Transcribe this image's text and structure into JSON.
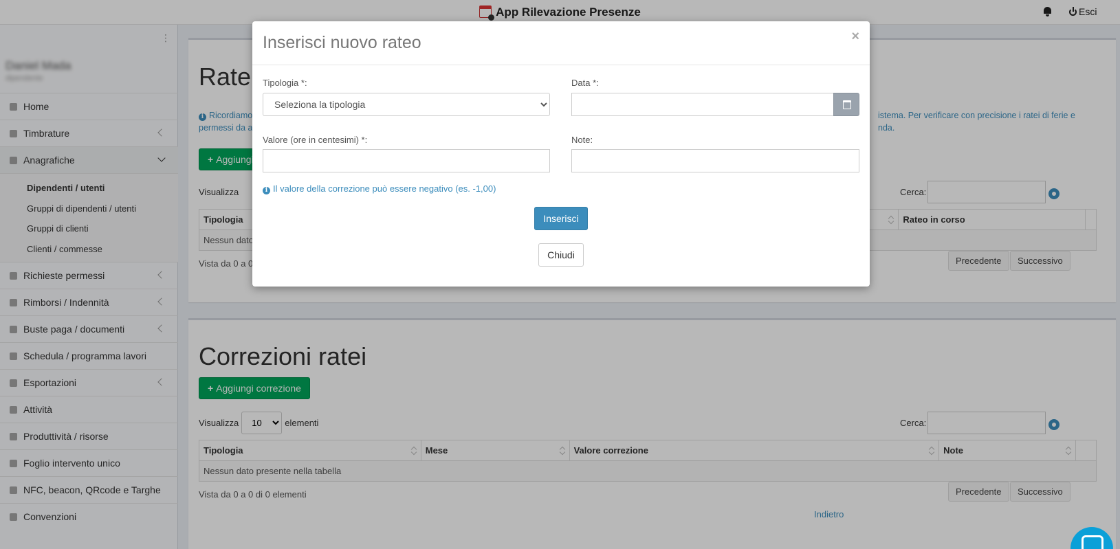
{
  "app": {
    "title": "App Rilevazione Presenze",
    "logout_label": "Esci"
  },
  "sidebar": {
    "user_name": "Daniel Mada",
    "user_sub": "dipendente",
    "items": [
      {
        "label": "Home",
        "icon": "home-icon"
      },
      {
        "label": "Timbrature",
        "icon": "list-icon"
      },
      {
        "label": "Anagrafiche",
        "icon": "users-icon"
      },
      {
        "label": "Richieste permessi",
        "icon": "comment-icon"
      },
      {
        "label": "Rimborsi / Indennità",
        "icon": "book-icon"
      },
      {
        "label": "Buste paga / documenti",
        "icon": "file-icon"
      },
      {
        "label": "Schedula / programma lavori",
        "icon": "briefcase-icon"
      },
      {
        "label": "Esportazioni",
        "icon": "cloud-icon"
      },
      {
        "label": "Attività",
        "icon": "sliders-icon"
      },
      {
        "label": "Produttività / risorse",
        "icon": "tool-icon"
      },
      {
        "label": "Foglio intervento unico",
        "icon": "doc-icon"
      },
      {
        "label": "NFC, beacon, QRcode e Targhe",
        "icon": "tags-icon"
      },
      {
        "label": "Convenzioni",
        "icon": "gift-icon"
      }
    ],
    "submenu": [
      {
        "label": "Dipendenti / utenti"
      },
      {
        "label": "Gruppi di dipendenti / utenti"
      },
      {
        "label": "Gruppi di clienti"
      },
      {
        "label": "Clienti / commesse"
      }
    ]
  },
  "ratei": {
    "title": "Ratei",
    "info_left_1": "Ricordiamo",
    "info_left_2": "permessi da a",
    "info_right_1": "istema. Per verificare con precisione i ratei di ferie e",
    "info_right_2": "nda.",
    "add_label": "Aggiungi",
    "show_label": "Visualizza",
    "search_label": "Cerca:",
    "col_first": "Tipologia",
    "col_last": "Rateo in corso",
    "empty": "Nessun dato",
    "info": "Vista da 0 a 0",
    "prev": "Precedente",
    "next": "Successivo"
  },
  "correzioni": {
    "title": "Correzioni ratei",
    "add_label": "Aggiungi correzione",
    "show_label": "Visualizza",
    "page_size": "10",
    "elements_label": "elementi",
    "search_label": "Cerca:",
    "columns": [
      "Tipologia",
      "Mese",
      "Valore correzione",
      "Note"
    ],
    "empty": "Nessun dato presente nella tabella",
    "info": "Vista da 0 a 0 di 0 elementi",
    "prev": "Precedente",
    "next": "Successivo",
    "back": "Indietro"
  },
  "modal": {
    "title": "Inserisci nuovo rateo",
    "close": "×",
    "tipologia_label": "Tipologia *:",
    "tipologia_placeholder": "Seleziona la tipologia",
    "data_label": "Data *:",
    "valore_label": "Valore (ore in centesimi) *:",
    "note_label": "Note:",
    "hint": "Il valore della correzione può essere negativo (es. -1,00)",
    "submit": "Inserisci",
    "close_button": "Chiudi"
  },
  "colors": {
    "primary": "#3c8dbc",
    "success": "#00a65a"
  }
}
